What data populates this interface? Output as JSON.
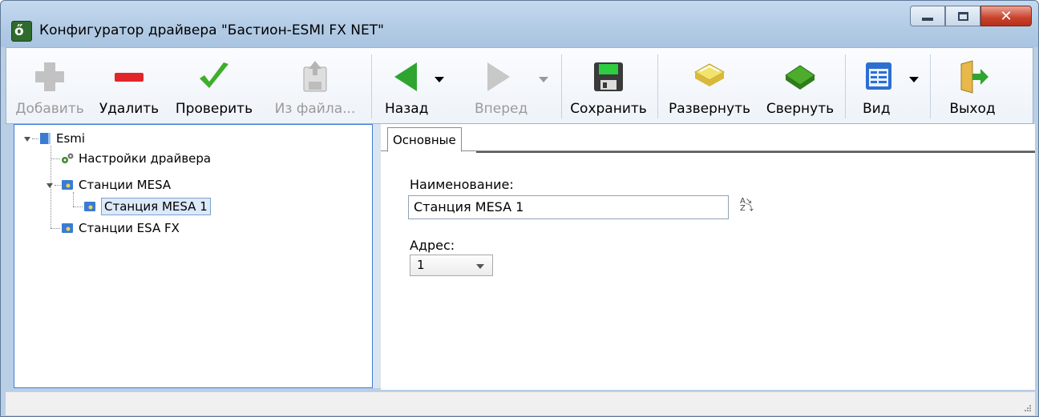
{
  "window": {
    "title": "Конфигуратор драйвера \"Бастион-ESMI FX NET\"",
    "icon": "app-icon",
    "controls": [
      "minimize",
      "maximize",
      "close"
    ]
  },
  "toolbar": {
    "add_label": "Добавить",
    "delete_label": "Удалить",
    "check_label": "Проверить",
    "from_file_label": "Из файла...",
    "back_label": "Назад",
    "forward_label": "Вперед",
    "save_label": "Сохранить",
    "expand_label": "Развернуть",
    "collapse_label": "Свернуть",
    "view_label": "Вид",
    "exit_label": "Выход"
  },
  "tree": {
    "root": "Esmi",
    "items": [
      {
        "label": "Настройки драйвера",
        "icon": "gears-icon"
      },
      {
        "label": "Станции MESA",
        "icon": "station-folder-icon"
      },
      {
        "label": "Станция MESA 1",
        "icon": "station-icon",
        "selected": true
      },
      {
        "label": "Станции ESA FX",
        "icon": "station-folder-icon"
      }
    ]
  },
  "tabs": [
    {
      "label": "Основные",
      "active": true
    }
  ],
  "form": {
    "name_label": "Наименование:",
    "name_value": "Станция MESA 1",
    "address_label": "Адрес:",
    "address_value": "1"
  },
  "colors": {
    "titlebar": "#b9cfe6",
    "close_button": "#c9412b",
    "selection": "#dce9f8",
    "tree_border": "#3f7fd6"
  }
}
